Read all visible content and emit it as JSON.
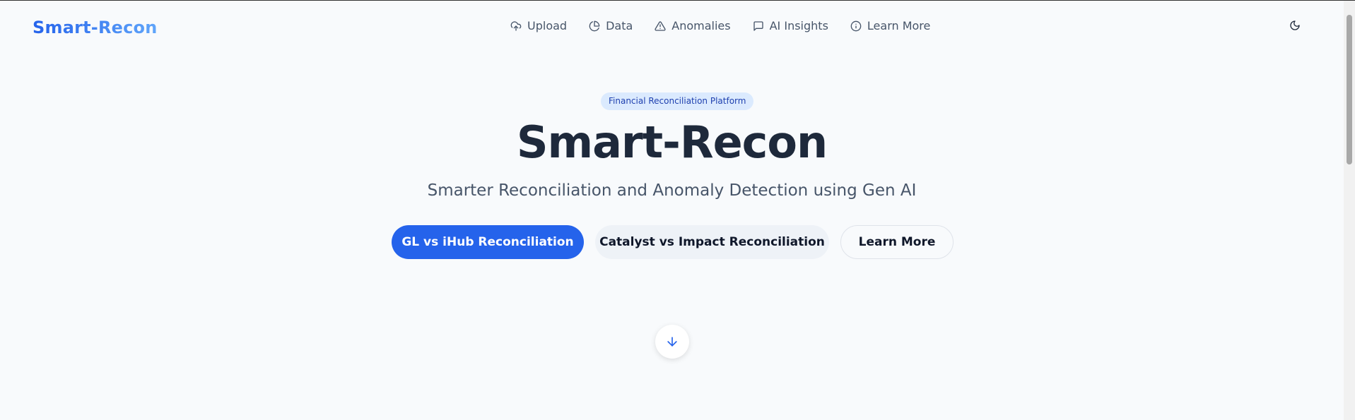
{
  "header": {
    "logo": "Smart-Recon",
    "nav": [
      {
        "label": "Upload",
        "icon": "upload-cloud-icon"
      },
      {
        "label": "Data",
        "icon": "pie-chart-icon"
      },
      {
        "label": "Anomalies",
        "icon": "alert-triangle-icon"
      },
      {
        "label": "AI Insights",
        "icon": "message-square-icon"
      },
      {
        "label": "Learn More",
        "icon": "info-icon"
      }
    ],
    "theme_toggle_icon": "moon-icon"
  },
  "hero": {
    "badge": "Financial Reconciliation Platform",
    "title": "Smart-Recon",
    "subtitle": "Smarter Reconciliation and Anomaly Detection using Gen AI",
    "buttons": {
      "primary": "GL vs iHub Reconciliation",
      "secondary": "Catalyst vs Impact Reconciliation",
      "outline": "Learn More"
    },
    "scroll_icon": "arrow-down-icon"
  },
  "colors": {
    "accent": "#2563eb",
    "background": "#f8fafc",
    "badge_bg": "#dbeafe",
    "title": "#1e293b"
  }
}
